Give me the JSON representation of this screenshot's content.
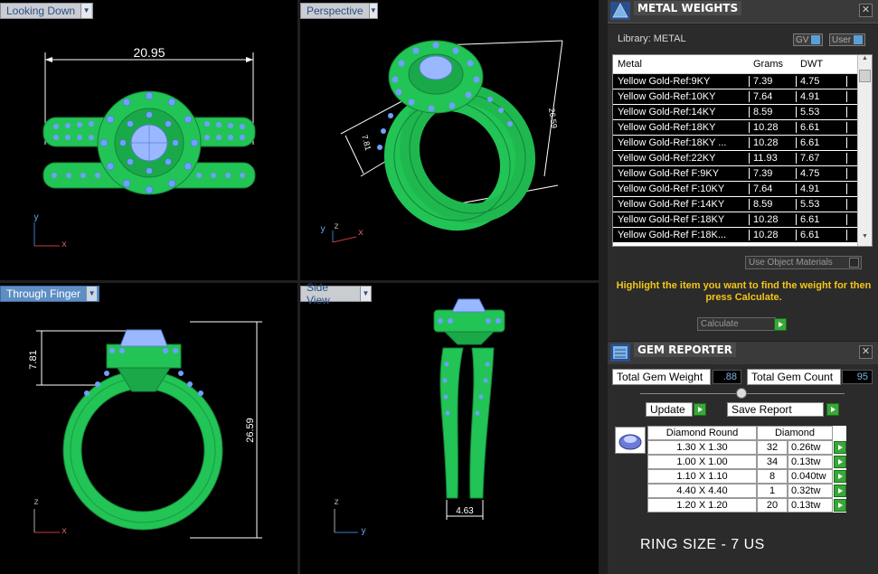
{
  "viewports": {
    "top_left": {
      "label": "Looking Down",
      "dimension": "20.95"
    },
    "top_right": {
      "label": "Perspective",
      "dimensions": [
        "7.81",
        "26.59"
      ]
    },
    "bottom_left": {
      "label": "Through Finger",
      "dimensions": [
        "7.81",
        "26.59"
      ]
    },
    "bottom_right": {
      "label": "Side View",
      "dimension": "4.63"
    },
    "axis_labels": {
      "x": "x",
      "y": "y",
      "z": "z"
    }
  },
  "metal_weights": {
    "title": "METAL WEIGHTS",
    "library_label": "Library: METAL",
    "gv_label": "GV",
    "user_label": "User",
    "columns": [
      "Metal",
      "Grams",
      "DWT"
    ],
    "rows": [
      [
        "Yellow Gold-Ref:9KY",
        "7.39",
        "4.75"
      ],
      [
        "Yellow Gold-Ref:10KY",
        "7.64",
        "4.91"
      ],
      [
        "Yellow Gold-Ref:14KY",
        "8.59",
        "5.53"
      ],
      [
        "Yellow Gold-Ref:18KY",
        "10.28",
        "6.61"
      ],
      [
        "Yellow Gold-Ref:18KY ...",
        "10.28",
        "6.61"
      ],
      [
        "Yellow Gold-Ref:22KY",
        "11.93",
        "7.67"
      ],
      [
        "Yellow Gold-Ref F:9KY",
        "7.39",
        "4.75"
      ],
      [
        "Yellow Gold-Ref F:10KY",
        "7.64",
        "4.91"
      ],
      [
        "Yellow Gold-Ref F:14KY",
        "8.59",
        "5.53"
      ],
      [
        "Yellow Gold-Ref F:18KY",
        "10.28",
        "6.61"
      ],
      [
        "Yellow Gold-Ref F:18K...",
        "10.28",
        "6.61"
      ]
    ],
    "use_object_materials": "Use Object Materials",
    "hint": "Highlight the item you want to find the weight for then press Calculate.",
    "calculate": "Calculate"
  },
  "gem_reporter": {
    "title": "GEM REPORTER",
    "total_weight_label": "Total Gem Weight",
    "total_weight_value": ".88",
    "total_count_label": "Total Gem Count",
    "total_count_value": "95",
    "update_label": "Update",
    "save_report_label": "Save Report",
    "table_header": [
      "Diamond Round",
      "Diamond"
    ],
    "rows": [
      [
        "1.30 X 1.30",
        "32",
        "0.26tw"
      ],
      [
        "1.00 X 1.00",
        "34",
        "0.13tw"
      ],
      [
        "1.10 X 1.10",
        "8",
        "0.040tw"
      ],
      [
        "4.40 X 4.40",
        "1",
        "0.32tw"
      ],
      [
        "1.20 X 1.20",
        "20",
        "0.13tw"
      ]
    ]
  },
  "ring_size": "RING SIZE - 7 US",
  "colors": {
    "ring_green": "#33dd66",
    "gem_blue": "#7aa8ff",
    "accent_blue": "#5e8ec4",
    "hint_yellow": "#f5c518"
  }
}
